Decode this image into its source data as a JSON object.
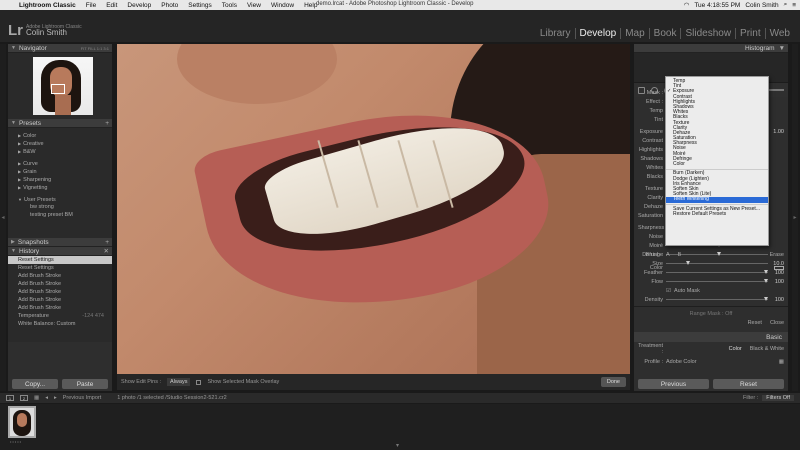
{
  "menubar": {
    "app": "Lightroom Classic",
    "items": [
      "File",
      "Edit",
      "Develop",
      "Photo",
      "Settings",
      "Tools",
      "View",
      "Window",
      "Help"
    ],
    "document": "demo.lrcat - Adobe Photoshop Lightroom Classic - Develop",
    "clock": "Tue 4:18:55 PM",
    "user": "Colin Smith"
  },
  "header": {
    "logo": "Lr",
    "product": "Adobe Lightroom Classic",
    "user": "Colin Smith",
    "modules": [
      "Library",
      "Develop",
      "Map",
      "Book",
      "Slideshow",
      "Print",
      "Web"
    ],
    "active_module": "Develop"
  },
  "left_panel": {
    "navigator": {
      "title": "Navigator",
      "zoom_options": "FIT FILL 1:1 3:1"
    },
    "presets": {
      "title": "Presets",
      "groups": [
        "Color",
        "Creative",
        "B&W",
        "Curve",
        "Grain",
        "Sharpening",
        "Vignetting",
        "User Presets"
      ],
      "user_presets": [
        "bw strong",
        "testing preset BM"
      ]
    },
    "snapshots": {
      "title": "Snapshots"
    },
    "history": {
      "title": "History",
      "rows": [
        {
          "label": "Reset Settings",
          "value": ""
        },
        {
          "label": "Reset Settings",
          "value": ""
        },
        {
          "label": "Add Brush Stroke",
          "value": ""
        },
        {
          "label": "Add Brush Stroke",
          "value": ""
        },
        {
          "label": "Add Brush Stroke",
          "value": ""
        },
        {
          "label": "Add Brush Stroke",
          "value": ""
        },
        {
          "label": "Add Brush Stroke",
          "value": ""
        },
        {
          "label": "Temperature",
          "value": "-124   474"
        },
        {
          "label": "White Balance: Custom",
          "value": ""
        }
      ]
    },
    "copy_label": "Copy...",
    "paste_label": "Paste"
  },
  "photobar": {
    "show_edit_pins_label": "Show Edit Pins :",
    "show_edit_pins_value": "Always",
    "overlay_label": "Show Selected Mask Overlay",
    "done_label": "Done"
  },
  "right_panel": {
    "histogram_title": "Histogram",
    "mask_label": "Mask :",
    "effect_label": "Effect :",
    "left_labels": [
      "Temp",
      "Tint",
      "Exposure",
      "Contrast",
      "Highlights",
      "Shadows",
      "Whites",
      "Blacks",
      "Texture",
      "Clarity",
      "Dehaze",
      "Saturation",
      "Sharpness",
      "Noise",
      "Moiré",
      "Defringe"
    ],
    "exposure_value": "1.00",
    "color_label": "Color",
    "brush": {
      "brush_label": "Brush :",
      "a_label": "A",
      "b_label": "B",
      "erase_label": "Erase",
      "size_label": "Size",
      "size_value": "10.0",
      "feather_label": "Feather",
      "feather_value": "100",
      "flow_label": "Flow",
      "flow_value": "100",
      "automask_label": "Auto Mask",
      "density_label": "Density",
      "density_value": "100",
      "range_mask_label": "Range Mask : Off",
      "reset_label": "Reset",
      "close_label": "Close"
    },
    "basic_title": "Basic",
    "treatment_label": "Treatment :",
    "treatment_color": "Color",
    "treatment_bw": "Black & White",
    "profile_label": "Profile :",
    "profile_value": "Adobe Color",
    "previous_label": "Previous",
    "reset_label": "Reset"
  },
  "dropdown_menu": {
    "group1": [
      "Temp",
      "Tint",
      "Exposure",
      "Contrast",
      "Highlights",
      "Shadows",
      "Whites",
      "Blacks",
      "Texture",
      "Clarity",
      "Dehaze",
      "Saturation",
      "Sharpness",
      "Noise",
      "Moiré",
      "Defringe",
      "Color"
    ],
    "checked_item": "Exposure",
    "group2": [
      "Burn (Darken)",
      "Dodge (Lighten)",
      "Iris Enhance",
      "Soften Skin",
      "Soften Skin (Lite)",
      "Teeth Whitening"
    ],
    "highlighted_item": "Teeth Whitening",
    "group3": [
      "Save Current Settings as New Preset...",
      "Restore Default Presets"
    ]
  },
  "filmstrip": {
    "monitor_1": "1",
    "monitor_2": "2",
    "source": "Previous Import",
    "selection": "1 photo /1 selected /Studio Session2-521.cr2",
    "filter_label": "Filter :",
    "filter_value": "Filters Off",
    "stars": "•••••"
  },
  "colors": {
    "menu_highlight": "#2a6ad6",
    "panel_bg": "#2e2e2e",
    "lip_color": "#b65e55",
    "skin_color": "#c28a6c"
  }
}
